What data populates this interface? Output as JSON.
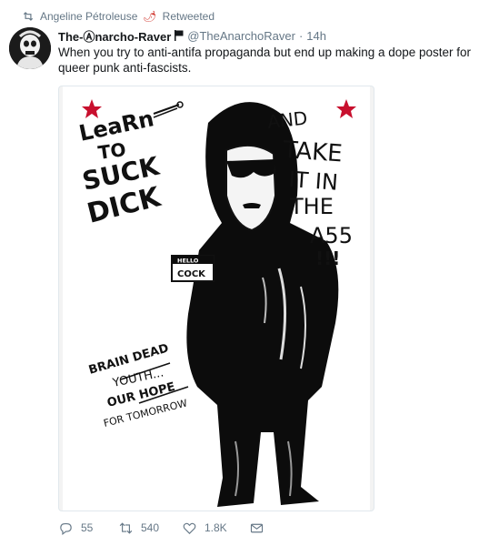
{
  "retweet": {
    "retweeter": "Angeline Pétroleuse",
    "emoji": "🌶",
    "label": "Retweeted"
  },
  "author": {
    "display_name": "The-Ⓐnarcho-Raver",
    "handle": "@TheAnarchoRaver",
    "separator": "·",
    "time": "14h"
  },
  "tweet": {
    "text": "When you try to anti-antifa propaganda but end up making a dope poster for queer punk anti-fascists."
  },
  "poster": {
    "left_text": [
      "LeaRn",
      "TO",
      "SUCK",
      "DICK"
    ],
    "right_text": [
      "AND",
      "TAKE",
      "IT IN",
      "THE",
      "A55",
      "!!!"
    ],
    "badge_top": "HELLO",
    "badge_name": "COCK",
    "bottom_text": [
      "BRAIN DEAD",
      "YOUTH...",
      "OUR HOPE",
      "FOR TOMORROW"
    ]
  },
  "actions": {
    "replies": "55",
    "retweets": "540",
    "likes": "1.8K"
  },
  "colors": {
    "muted": "#657786",
    "text": "#14171a",
    "star": "#c8102e"
  }
}
